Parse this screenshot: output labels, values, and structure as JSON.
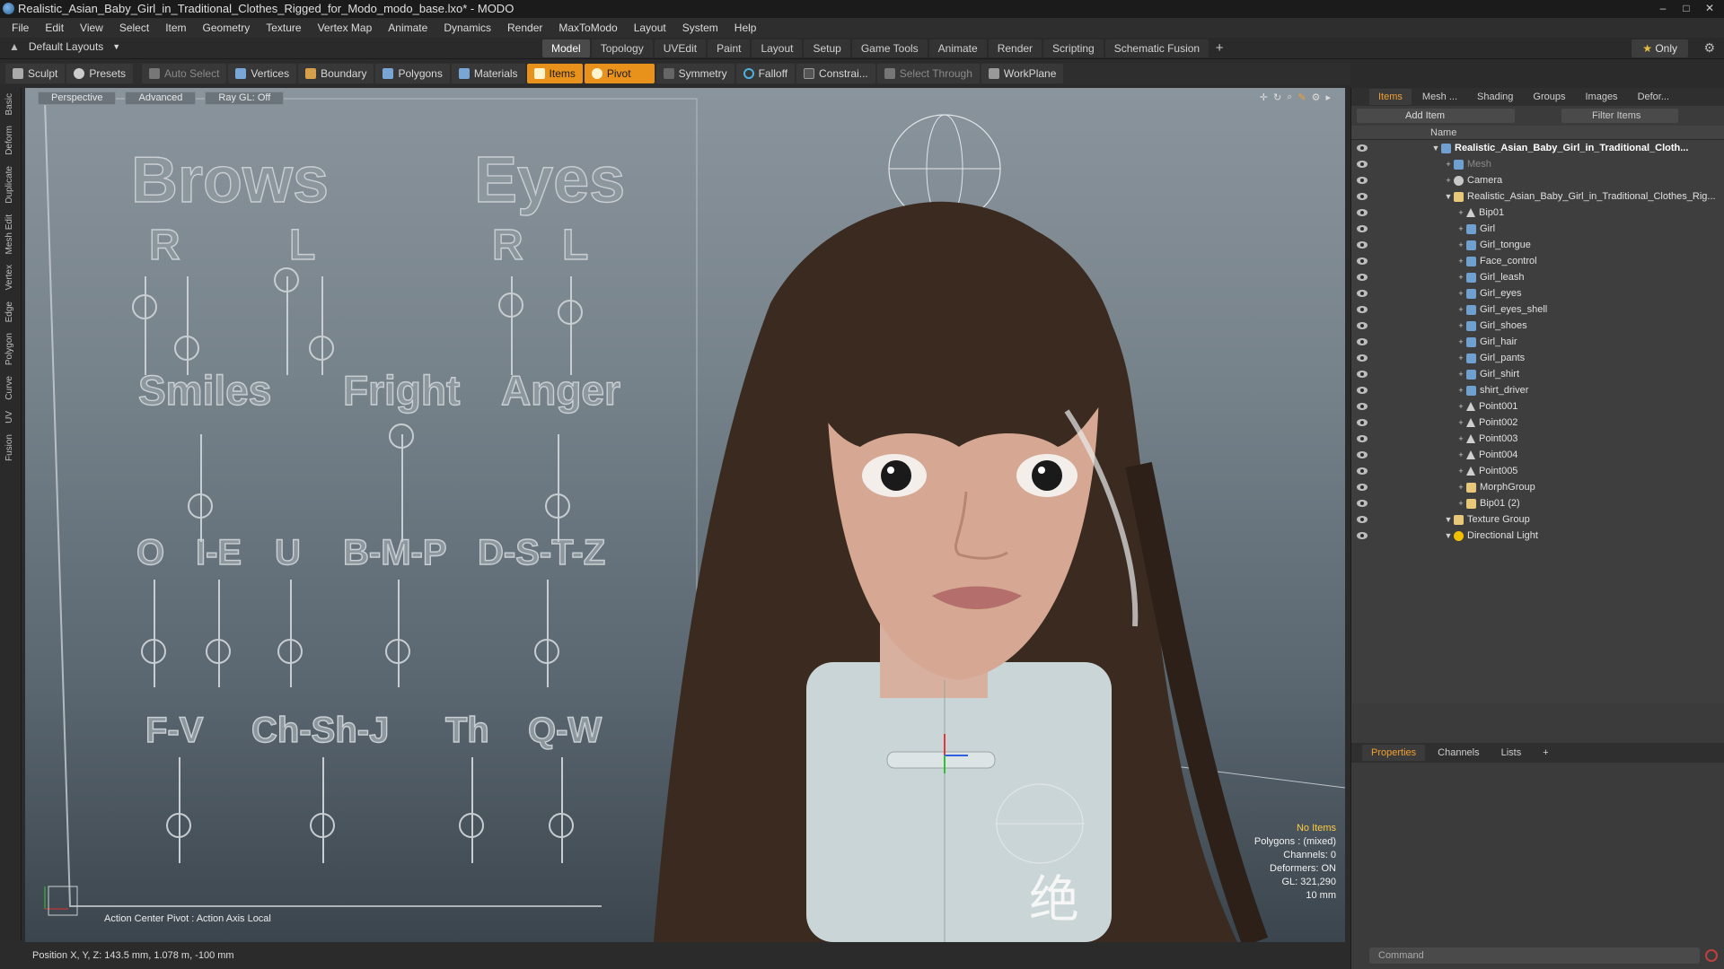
{
  "window": {
    "title": "Realistic_Asian_Baby_Girl_in_Traditional_Clothes_Rigged_for_Modo_modo_base.lxo* - MODO",
    "controls": [
      "–",
      "□",
      "✕"
    ]
  },
  "menu": [
    "File",
    "Edit",
    "View",
    "Select",
    "Item",
    "Geometry",
    "Texture",
    "Vertex Map",
    "Animate",
    "Dynamics",
    "Render",
    "MaxToModo",
    "Layout",
    "System",
    "Help"
  ],
  "layout_bar": {
    "layouts_label": "Default Layouts",
    "tabs": [
      "Model",
      "Topology",
      "UVEdit",
      "Paint",
      "Layout",
      "Setup",
      "Game Tools",
      "Animate",
      "Render",
      "Scripting",
      "Schematic Fusion"
    ],
    "active_tab": "Model",
    "add": "+",
    "only_label": "Only"
  },
  "toolbar": {
    "items": [
      {
        "label": "Sculpt",
        "state": "normal"
      },
      {
        "label": "Presets",
        "state": "normal"
      },
      {
        "label": "Auto Select",
        "state": "dim"
      },
      {
        "label": "Vertices",
        "state": "normal"
      },
      {
        "label": "Boundary",
        "state": "normal"
      },
      {
        "label": "Polygons",
        "state": "normal"
      },
      {
        "label": "Materials",
        "state": "normal"
      },
      {
        "label": "Items",
        "state": "orange"
      },
      {
        "label": "Pivot",
        "state": "orange"
      },
      {
        "label": "Symmetry",
        "state": "normal"
      },
      {
        "label": "Falloff",
        "state": "normal"
      },
      {
        "label": "Constrai...",
        "state": "normal"
      },
      {
        "label": "Select Through",
        "state": "dim"
      },
      {
        "label": "WorkPlane",
        "state": "normal"
      }
    ]
  },
  "left_strip": [
    "Basic",
    "Deform",
    "Duplicate",
    "Mesh Edit",
    "Vertex",
    "Edge",
    "Polygon",
    "Curve",
    "UV",
    "Fusion"
  ],
  "viewport": {
    "buttons": [
      "Perspective",
      "Advanced",
      "Ray GL: Off"
    ],
    "face_controls": {
      "labels": [
        "Brows",
        "Eyes",
        "R",
        "L",
        "R",
        "L",
        "Smiles",
        "Fright",
        "Anger",
        "O",
        "I-E",
        "U",
        "B-M-P",
        "D-S-T-Z",
        "F-V",
        "Ch-Sh-J",
        "Th",
        "Q-W"
      ]
    },
    "info": {
      "selection": "No Items",
      "polygons": "Polygons : (mixed)",
      "channels": "Channels: 0",
      "deformers": "Deformers: ON",
      "gl": "GL: 321,290",
      "scale": "10 mm"
    },
    "action_center": "Action Center Pivot : Action Axis Local",
    "glyph": "绝"
  },
  "status": {
    "position": "Position X, Y, Z:   143.5 mm, 1.078 m, -100 mm"
  },
  "items_panel": {
    "tabs": [
      "Items",
      "Mesh ...",
      "Shading",
      "Groups",
      "Images",
      "Defor..."
    ],
    "active_tab": "Items",
    "add_item": "Add Item",
    "filter": "Filter Items",
    "column": "Name",
    "rows": [
      {
        "label": "Realistic_Asian_Baby_Girl_in_Traditional_Cloth...",
        "icon": "scene",
        "indent": 0,
        "style": "bold"
      },
      {
        "label": "Mesh",
        "icon": "mesh",
        "indent": 1,
        "style": "dim"
      },
      {
        "label": "Camera",
        "icon": "cam",
        "indent": 1,
        "style": "normal"
      },
      {
        "label": "Realistic_Asian_Baby_Girl_in_Traditional_Clothes_Rig...",
        "icon": "grp",
        "indent": 1,
        "style": "normal"
      },
      {
        "label": "Bip01",
        "icon": "loc",
        "indent": 2,
        "style": "normal"
      },
      {
        "label": "Girl",
        "icon": "mesh",
        "indent": 2,
        "style": "normal"
      },
      {
        "label": "Girl_tongue",
        "icon": "mesh",
        "indent": 2,
        "style": "normal"
      },
      {
        "label": "Face_control",
        "icon": "mesh",
        "indent": 2,
        "style": "normal"
      },
      {
        "label": "Girl_leash",
        "icon": "mesh",
        "indent": 2,
        "style": "normal"
      },
      {
        "label": "Girl_eyes",
        "icon": "mesh",
        "indent": 2,
        "style": "normal"
      },
      {
        "label": "Girl_eyes_shell",
        "icon": "mesh",
        "indent": 2,
        "style": "normal"
      },
      {
        "label": "Girl_shoes",
        "icon": "mesh",
        "indent": 2,
        "style": "normal"
      },
      {
        "label": "Girl_hair",
        "icon": "mesh",
        "indent": 2,
        "style": "normal"
      },
      {
        "label": "Girl_pants",
        "icon": "mesh",
        "indent": 2,
        "style": "normal"
      },
      {
        "label": "Girl_shirt",
        "icon": "mesh",
        "indent": 2,
        "style": "normal"
      },
      {
        "label": "shirt_driver",
        "icon": "mesh",
        "indent": 2,
        "style": "normal"
      },
      {
        "label": "Point001",
        "icon": "loc",
        "indent": 2,
        "style": "normal"
      },
      {
        "label": "Point002",
        "icon": "loc",
        "indent": 2,
        "style": "normal"
      },
      {
        "label": "Point003",
        "icon": "loc",
        "indent": 2,
        "style": "normal"
      },
      {
        "label": "Point004",
        "icon": "loc",
        "indent": 2,
        "style": "normal"
      },
      {
        "label": "Point005",
        "icon": "loc",
        "indent": 2,
        "style": "normal"
      },
      {
        "label": "MorphGroup",
        "icon": "grp",
        "indent": 2,
        "style": "normal"
      },
      {
        "label": "Bip01 (2)",
        "icon": "grp",
        "indent": 2,
        "style": "normal"
      },
      {
        "label": "Texture Group",
        "icon": "grp",
        "indent": 1,
        "style": "normal"
      },
      {
        "label": "Directional Light",
        "icon": "light",
        "indent": 1,
        "style": "normal"
      }
    ]
  },
  "properties_panel": {
    "tabs": [
      "Properties",
      "Channels",
      "Lists",
      "+"
    ],
    "active_tab": "Properties"
  },
  "command": {
    "placeholder": "Command"
  },
  "colors": {
    "accent_orange": "#e8921c",
    "viewport_top": "#8a949c",
    "viewport_bottom": "#3b454d",
    "panel_bg": "#3b3b3b"
  }
}
